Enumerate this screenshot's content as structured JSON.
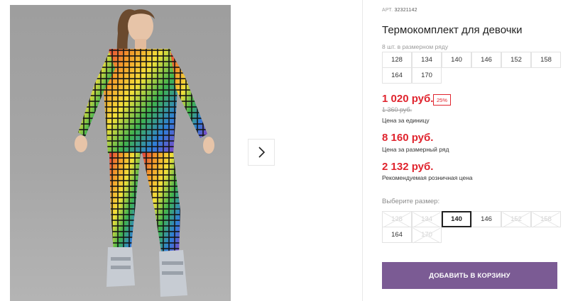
{
  "product": {
    "art_label": "АРТ.",
    "art_code": "32321142",
    "title": "Термокомплект для девочки"
  },
  "size_range": {
    "caption": "8 шт. в размерном ряду",
    "sizes": [
      "128",
      "134",
      "140",
      "146",
      "152",
      "158",
      "164",
      "170"
    ]
  },
  "pricing": {
    "unit_price": "1 020 руб.",
    "discount_badge": "25%",
    "old_price": "1 360 руб.",
    "unit_caption": "Цена за единицу",
    "range_price": "8 160 руб.",
    "range_caption": "Цена за размерный ряд",
    "retail_price": "2 132 руб.",
    "retail_caption": "Рекомендуемая розничная цена",
    "price_color": "#e0242e"
  },
  "size_select": {
    "label": "Выберите размер:",
    "options": [
      {
        "value": "128",
        "state": "disabled"
      },
      {
        "value": "134",
        "state": "disabled"
      },
      {
        "value": "140",
        "state": "selected"
      },
      {
        "value": "146",
        "state": "enabled"
      },
      {
        "value": "152",
        "state": "disabled"
      },
      {
        "value": "158",
        "state": "disabled"
      },
      {
        "value": "164",
        "state": "enabled"
      },
      {
        "value": "170",
        "state": "disabled"
      }
    ]
  },
  "cart": {
    "button_label": "ДОБАВИТЬ В КОРЗИНУ",
    "button_color": "#7b5b94"
  },
  "gallery": {
    "next_icon": "chevron-right-icon"
  }
}
